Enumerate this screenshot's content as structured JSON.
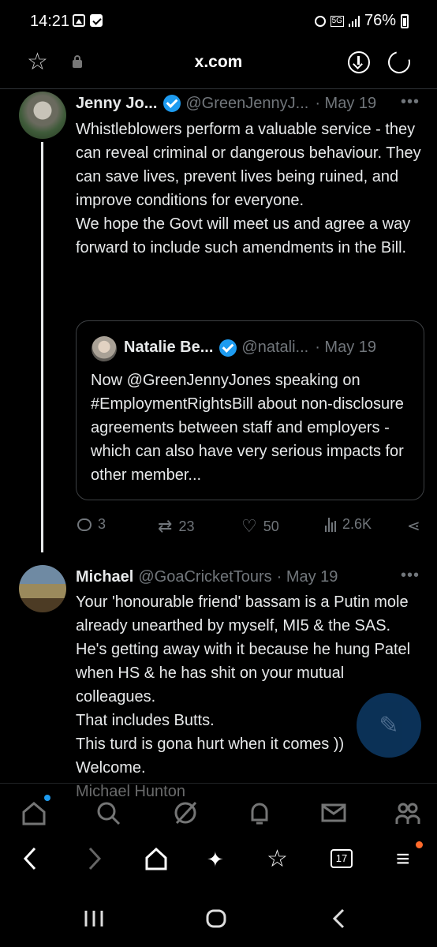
{
  "status_bar": {
    "time": "14:21",
    "network": "5G",
    "battery": "76%"
  },
  "browser": {
    "url": "x.com",
    "icons": [
      "star-icon",
      "lock-icon",
      "download-icon",
      "reload-icon"
    ]
  },
  "tweet1": {
    "name": "Jenny Jo...",
    "handle": "@GreenJennyJ...",
    "date": "· May 19",
    "more": "•••",
    "text": "Whistleblowers perform a valuable service - they can reveal criminal or dangerous behaviour. They can save lives, prevent lives being ruined, and improve conditions for everyone.\nWe hope the Govt will meet us and agree a way forward to include such amendments in the Bill.",
    "quote": {
      "name": "Natalie Be...",
      "handle": "@natali...",
      "date": "· May 19",
      "text": "Now @GreenJennyJones speaking  on #EmploymentRightsBill about non-disclosure agreements between staff and employers - which can also have very serious impacts for other member..."
    },
    "stats": {
      "replies": "3",
      "reposts": "23",
      "likes": "50",
      "views": "2.6K"
    }
  },
  "tweet2": {
    "name": "Michael",
    "handle": "@GoaCricketTours",
    "date": "· May 19",
    "more": "•••",
    "text": "Your 'honourable friend' bassam is a Putin mole already unearthed by myself, MI5 & the SAS.\nHe's getting away with it because he hung Patel when HS & he has shit on your mutual colleagues.\nThat includes Butts.\nThis turd is gona hurt when it comes ))\nWelcome.\nMichael Hunton"
  },
  "bottom_nav": [
    "home-icon",
    "search-icon",
    "grok-icon",
    "notifications-icon",
    "messages-icon",
    "communities-icon"
  ],
  "browser_toolbar": {
    "tabs_count": "17",
    "icons": [
      "back-icon",
      "forward-icon",
      "home-icon",
      "sparkle-icon",
      "bookmarks-icon",
      "tabs-icon",
      "menu-icon"
    ]
  },
  "colors": {
    "background": "#000000",
    "text": "#e7e9ea",
    "muted": "#71767b",
    "verified": "#1d9bf0",
    "menu_notification": "#ff6a2b"
  }
}
